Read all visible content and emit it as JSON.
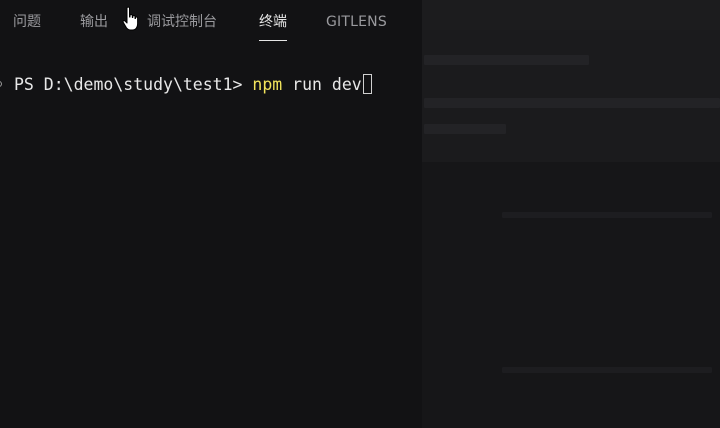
{
  "panel": {
    "tabs": [
      {
        "label": "问题",
        "active": false
      },
      {
        "label": "输出",
        "active": false
      },
      {
        "label": "调试控制台",
        "active": false
      },
      {
        "label": "终端",
        "active": true
      },
      {
        "label": "GITLENS",
        "active": false
      }
    ]
  },
  "terminal": {
    "prompt": "PS D:\\demo\\study\\test1> ",
    "command": "npm",
    "args": " run dev"
  },
  "colors": {
    "background": "#121214",
    "command_highlight": "#f2e45c",
    "text": "#e8e8e8",
    "tab_inactive": "#9a9a9e",
    "tab_active": "#e6e6e6"
  },
  "icons": {
    "pointer": "hand-pointer-icon",
    "decoration": "terminal-command-decoration-icon"
  }
}
